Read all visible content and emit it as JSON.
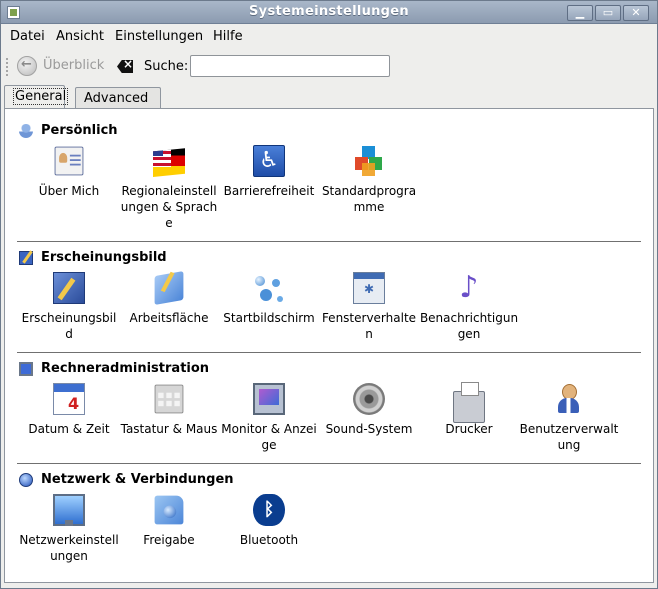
{
  "window": {
    "title": "Systemeinstellungen",
    "controls": [
      "▁",
      "▭",
      "✕"
    ]
  },
  "menu": {
    "items": [
      {
        "label": "Datei"
      },
      {
        "label": "Ansicht"
      },
      {
        "label": "Einstellungen"
      },
      {
        "label": "Hilfe"
      }
    ]
  },
  "toolbar": {
    "back_label": "Überblick",
    "search_label": "Suche:",
    "search_value": "",
    "search_placeholder": ""
  },
  "tabs": [
    {
      "label": "General",
      "active": true
    },
    {
      "label": "Advanced",
      "active": false
    }
  ],
  "sections": [
    {
      "title": "Persönlich",
      "icon": "user-icon",
      "items": [
        {
          "label": "Über Mich",
          "icon": "user-card-icon"
        },
        {
          "label": "Regionaleinstellungen & Sprache",
          "icon": "flags-icon"
        },
        {
          "label": "Barrierefreiheit",
          "icon": "accessibility-icon"
        },
        {
          "label": "Standardprogramme",
          "icon": "cubes-icon"
        }
      ]
    },
    {
      "title": "Erscheinungsbild",
      "icon": "paint-icon",
      "items": [
        {
          "label": "Erscheinungsbild",
          "icon": "paint-brush-icon"
        },
        {
          "label": "Arbeitsfläche",
          "icon": "desktop-icon"
        },
        {
          "label": "Startbildschirm",
          "icon": "bubbles-icon"
        },
        {
          "label": "Fensterverhalten",
          "icon": "window-icon"
        },
        {
          "label": "Benachrichtigungen",
          "icon": "music-note-icon"
        }
      ]
    },
    {
      "title": "Rechneradministration",
      "icon": "monitor-icon",
      "items": [
        {
          "label": "Datum & Zeit",
          "icon": "calendar-icon"
        },
        {
          "label": "Tastatur & Maus",
          "icon": "keyboard-icon"
        },
        {
          "label": "Monitor & Anzeige",
          "icon": "display-icon"
        },
        {
          "label": "Sound-System",
          "icon": "speaker-icon"
        },
        {
          "label": "Drucker",
          "icon": "printer-icon"
        },
        {
          "label": "Benutzerverwaltung",
          "icon": "user-admin-icon"
        }
      ]
    },
    {
      "title": "Netzwerk & Verbindungen",
      "icon": "globe-icon",
      "items": [
        {
          "label": "Netzwerkeinstellungen",
          "icon": "network-icon"
        },
        {
          "label": "Freigabe",
          "icon": "sharing-icon"
        },
        {
          "label": "Bluetooth",
          "icon": "bluetooth-icon"
        }
      ]
    }
  ]
}
